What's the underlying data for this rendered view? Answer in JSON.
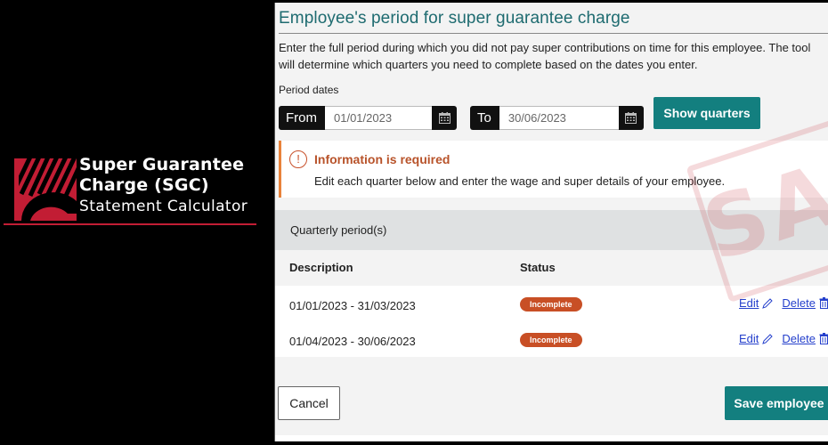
{
  "brand": {
    "line1": "Super Guarantee",
    "line2": "Charge (SGC)",
    "line3": "Statement Calculator",
    "accent_color": "#c21d34"
  },
  "form": {
    "title": "Employee's period for super guarantee charge",
    "intro": "Enter the full period during which you did not pay super contributions on time for this employee. The tool will determine which quarters you need to complete based on the dates you enter.",
    "period_label": "Period dates",
    "from": {
      "prefix": "From",
      "value": "01/01/2023",
      "icon": "calendar-icon"
    },
    "to": {
      "prefix": "To",
      "value": "30/06/2023",
      "icon": "calendar-icon"
    },
    "show_quarters_label": "Show quarters",
    "accent_color": "#137f7f"
  },
  "alert": {
    "icon": "exclamation-circle-icon",
    "title": "Information is required",
    "body": "Edit each quarter below and enter the wage and super details of your employee.",
    "color": "#e8823a"
  },
  "quarters": {
    "title": "Quarterly period(s)",
    "columns": [
      "Description",
      "Status"
    ],
    "rows": [
      {
        "description": "01/01/2023 - 31/03/2023",
        "status": "Incomplete",
        "edit": "Edit",
        "delete": "Delete"
      },
      {
        "description": "01/04/2023 - 30/06/2023",
        "status": "Incomplete",
        "edit": "Edit",
        "delete": "Delete"
      }
    ],
    "status_color": "#c84f25"
  },
  "footer": {
    "cancel_label": "Cancel",
    "save_label": "Save employee"
  },
  "watermark": {
    "text": "SAMPLE"
  }
}
